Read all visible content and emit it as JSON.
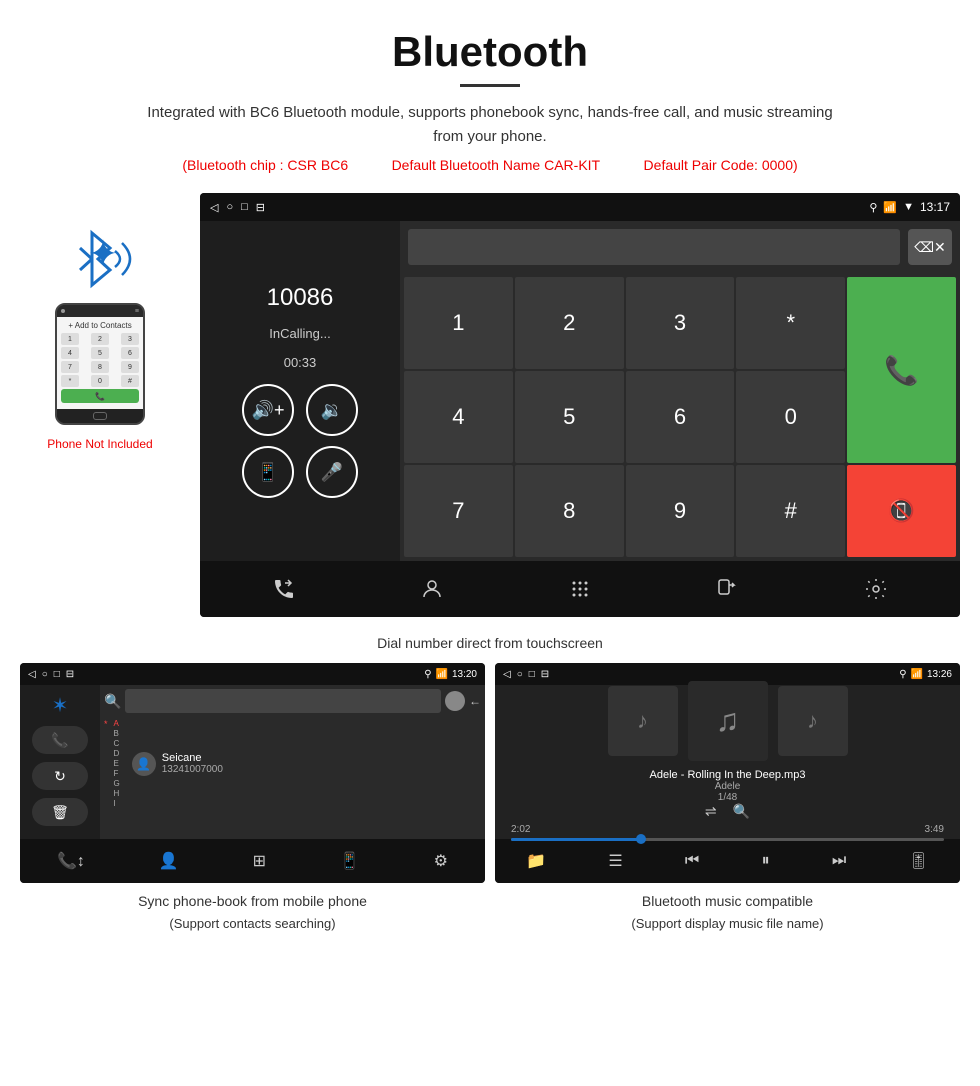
{
  "header": {
    "title": "Bluetooth",
    "description": "Integrated with BC6 Bluetooth module, supports phonebook sync, hands-free call, and music streaming from your phone.",
    "specs": {
      "chip": "(Bluetooth chip : CSR BC6",
      "name": "Default Bluetooth Name CAR-KIT",
      "code": "Default Pair Code: 0000)"
    }
  },
  "main_screen": {
    "status_bar": {
      "nav_back": "◁",
      "nav_home": "○",
      "nav_recent": "□",
      "nav_menu": "⊟",
      "location_icon": "📍",
      "phone_icon": "📞",
      "wifi_icon": "▼",
      "time": "13:17"
    },
    "dialer": {
      "phone_number": "10086",
      "status": "InCalling...",
      "timer": "00:33",
      "vol_up": "🔊+",
      "vol_down": "🔊-",
      "transfer": "📱",
      "mute": "🎤",
      "numpad": [
        "1",
        "2",
        "3",
        "*",
        "4",
        "5",
        "6",
        "0",
        "7",
        "8",
        "9",
        "#"
      ],
      "call_green": "📞",
      "call_red": "📞"
    },
    "bottom_bar": {
      "icons": [
        "📞",
        "👤",
        "⊞",
        "📱",
        "⚙"
      ]
    }
  },
  "dial_caption": "Dial number direct from touchscreen",
  "phone_side": {
    "not_included": "Phone Not Included"
  },
  "phonebook_screen": {
    "status_time": "13:20",
    "contact_name": "Seicane",
    "contact_number": "13241007000",
    "caption": "Sync phone-book from mobile phone",
    "caption_sub": "(Support contacts searching)"
  },
  "music_screen": {
    "status_time": "13:26",
    "track_name": "Adele - Rolling In the Deep.mp3",
    "artist": "Adele",
    "track_count": "1/48",
    "time_current": "2:02",
    "time_total": "3:49",
    "caption": "Bluetooth music compatible",
    "caption_sub": "(Support display music file name)"
  }
}
